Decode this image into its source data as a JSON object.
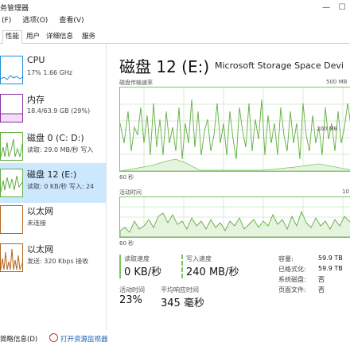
{
  "window": {
    "title": "务管理器",
    "controls": {
      "minimize": "—",
      "maximize": "☐"
    }
  },
  "menu": [
    "(F)",
    "选项(O)",
    "查看(V)"
  ],
  "tabs": [
    "性能",
    "用户",
    "详细信息",
    "服务"
  ],
  "sidebar": [
    {
      "name": "CPU",
      "sub": "17%  1.66 GHz",
      "sub2": "",
      "color": "#1e90d6"
    },
    {
      "name": "内存",
      "sub": "18.4/63.9 GB (29%)",
      "sub2": "",
      "color": "#8b2fa0"
    },
    {
      "name": "磁盘 0 (C: D:)",
      "sub": "读取: 29.0 MB/秒  写入",
      "sub2": "",
      "color": "#5fae3f"
    },
    {
      "name": "磁盘 12 (E:)",
      "sub": "读取: 0 KB/秒  写入: 24",
      "sub2": "",
      "color": "#5fae3f"
    },
    {
      "name": "以太网",
      "sub": "未连接",
      "sub2": "",
      "color": "#b5651d"
    },
    {
      "name": "以太网",
      "sub": "发送: 320 Kbps  接收",
      "sub2": "",
      "color": "#b5651d"
    }
  ],
  "main": {
    "heading": "磁盘 12 (E:)",
    "model": "Microsoft Storage Space Devi",
    "graph1": {
      "label": "磁盘传输速率",
      "max": "500 MB",
      "mid": "200 MB",
      "time": "60 秒"
    },
    "graph2": {
      "label": "活动时间",
      "max": "10",
      "time": "60 秒"
    },
    "stats": {
      "read_label": "读取速度",
      "read_value": "0 KB/秒",
      "write_label": "写入速度",
      "write_value": "240 MB/秒",
      "active_label": "活动时间",
      "active_value": "23%",
      "resp_label": "平均响应时间",
      "resp_value": "345 毫秒"
    },
    "properties": [
      {
        "label": "容量:",
        "value": "59.9 TB"
      },
      {
        "label": "已格式化:",
        "value": "59.9 TB"
      },
      {
        "label": "系统磁盘:",
        "value": "否"
      },
      {
        "label": "页面文件:",
        "value": "否"
      }
    ]
  },
  "footer": {
    "fewer": "简略信息(D)",
    "resmon": "打开资源监视器"
  },
  "colors": {
    "accent": "#5fae3f",
    "selected": "#cce8ff",
    "link": "#1a5fb4"
  }
}
